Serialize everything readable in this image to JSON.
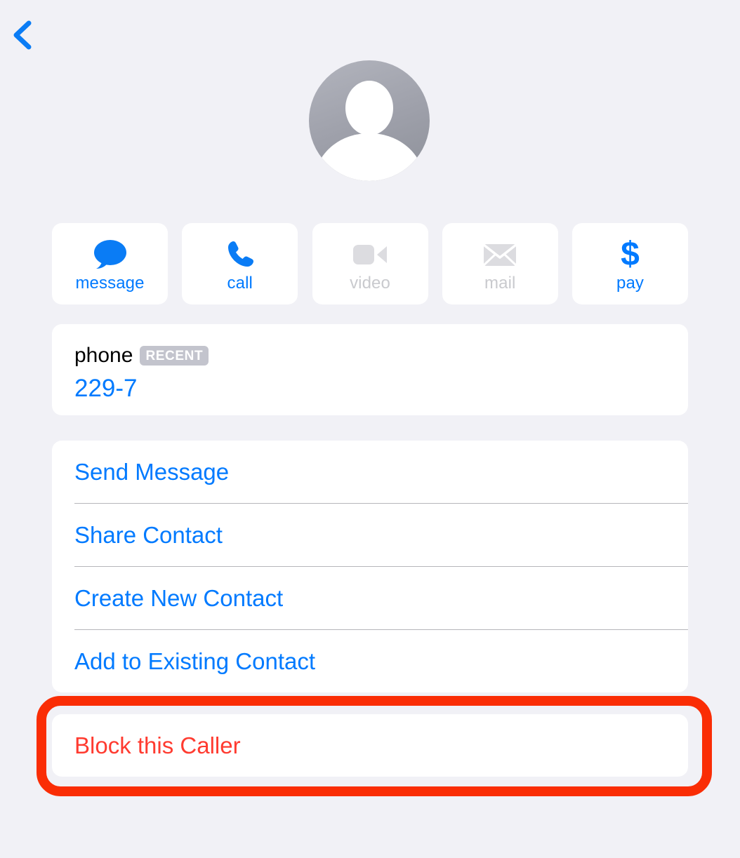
{
  "navbar": {
    "back_icon": "chevron-left-icon",
    "back_label": ""
  },
  "avatar": {
    "icon": "person-placeholder-icon",
    "background_color": "#9fa1ab"
  },
  "quick_actions": [
    {
      "id": "message",
      "label": "message",
      "icon": "message-bubble-icon",
      "enabled": true,
      "color": "#007aff"
    },
    {
      "id": "call",
      "label": "call",
      "icon": "phone-handset-icon",
      "enabled": true,
      "color": "#007aff"
    },
    {
      "id": "video",
      "label": "video",
      "icon": "video-camera-icon",
      "enabled": false,
      "color": "#c9cace"
    },
    {
      "id": "mail",
      "label": "mail",
      "icon": "envelope-icon",
      "enabled": false,
      "color": "#c9cace"
    },
    {
      "id": "pay",
      "label": "pay",
      "icon": "dollar-sign-icon",
      "enabled": true,
      "color": "#007aff"
    }
  ],
  "phone_card": {
    "label": "phone",
    "badge": "RECENT",
    "number": "229-7"
  },
  "action_list": [
    {
      "id": "send-message",
      "label": "Send Message"
    },
    {
      "id": "share-contact",
      "label": "Share Contact"
    },
    {
      "id": "create-new-contact",
      "label": "Create New Contact"
    },
    {
      "id": "add-to-existing-contact",
      "label": "Add to Existing Contact"
    }
  ],
  "block_card": {
    "label": "Block this Caller",
    "color": "#ff3b30"
  },
  "highlight": {
    "color": "#fa2d05",
    "target": "block-this-caller-row"
  },
  "colors": {
    "background": "#f1f1f6",
    "card": "#ffffff",
    "accent": "#007aff",
    "destructive": "#ff3b30",
    "disabled": "#c9cace",
    "separator": "#b6b6ba",
    "badge": "#c3c4cd"
  }
}
